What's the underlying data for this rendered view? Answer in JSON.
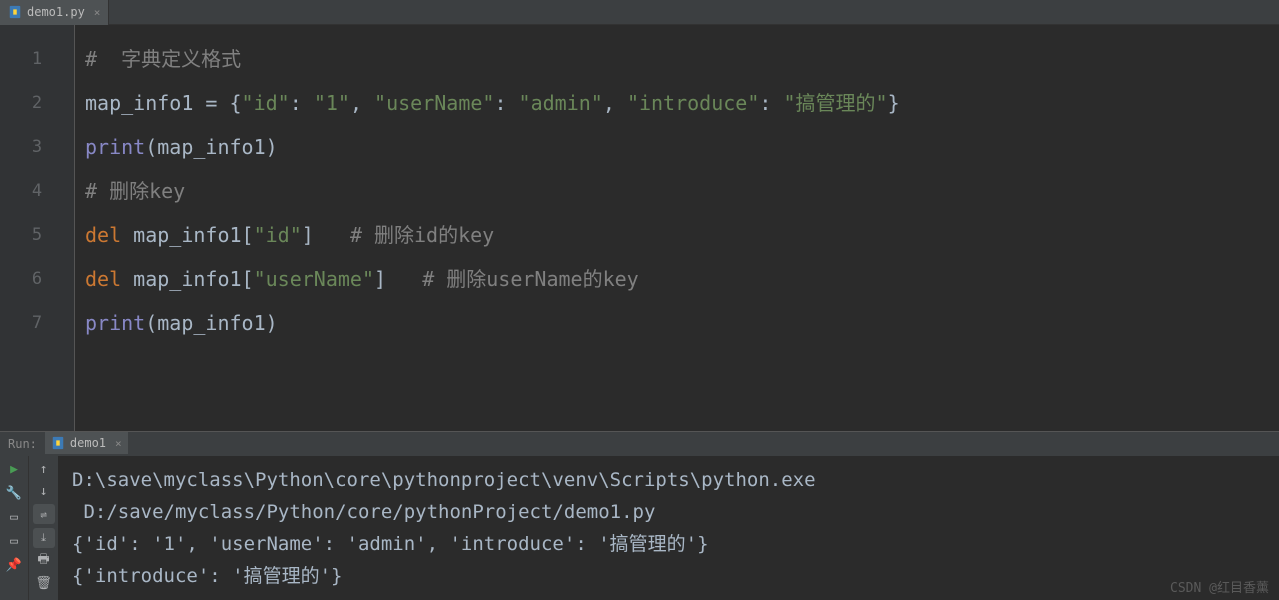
{
  "tab": {
    "filename": "demo1.py",
    "icon": "python-file-icon"
  },
  "gutter": [
    "1",
    "2",
    "3",
    "4",
    "5",
    "6",
    "7"
  ],
  "code": {
    "l1": {
      "comment": "#  字典定义格式"
    },
    "l2": {
      "var": "map_info1",
      "eq": " = ",
      "brace_open": "{",
      "k1": "\"id\"",
      "c1": ": ",
      "v1": "\"1\"",
      "sep1": ", ",
      "k2": "\"userName\"",
      "c2": ": ",
      "v2": "\"admin\"",
      "sep2": ", ",
      "k3": "\"introduce\"",
      "c3": ": ",
      "v3": "\"搞管理的\"",
      "brace_close": "}"
    },
    "l3": {
      "func": "print",
      "po": "(",
      "arg": "map_info1",
      "pc": ")"
    },
    "l4": {
      "comment": "# 删除key"
    },
    "l5": {
      "kw": "del ",
      "var": "map_info1",
      "bo": "[",
      "key": "\"id\"",
      "bc": "]",
      "space": "   ",
      "comment": "# 删除id的key"
    },
    "l6": {
      "kw": "del ",
      "var": "map_info1",
      "bo": "[",
      "key": "\"userName\"",
      "bc": "]",
      "space": "   ",
      "comment": "# 删除userName的key"
    },
    "l7": {
      "func": "print",
      "po": "(",
      "arg": "map_info1",
      "pc": ")"
    }
  },
  "run": {
    "label": "Run:",
    "tab_name": "demo1",
    "output": [
      "D:\\save\\myclass\\Python\\core\\pythonproject\\venv\\Scripts\\python.exe",
      " D:/save/myclass/Python/core/pythonProject/demo1.py",
      "{'id': '1', 'userName': 'admin', 'introduce': '搞管理的'}",
      "{'introduce': '搞管理的'}"
    ]
  },
  "watermark": "CSDN @红目香薰"
}
